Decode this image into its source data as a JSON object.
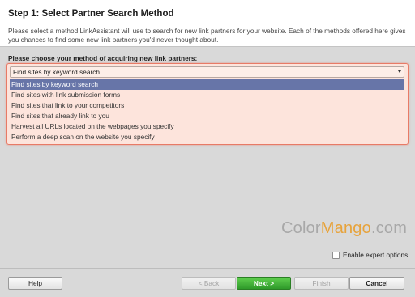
{
  "header": {
    "title": "Step 1: Select Partner Search Method",
    "description": "Please select a method LinkAssistant will use to search for new link partners for your website. Each of the methods offered here gives you chances to find some new link partners you'd never thought about."
  },
  "method": {
    "prompt": "Please choose your method of acquiring new link partners:",
    "selected": "Find sites by keyword search",
    "options": [
      "Find sites by keyword search",
      "Find sites with link submission forms",
      "Find sites that link to your competitors",
      "Find sites that already link to you",
      "Harvest all URLs located on the webpages you specify",
      "Perform a deep scan on the website you specify"
    ],
    "selected_index": 0
  },
  "watermark": {
    "part1": "Color",
    "part2": "Mango",
    "part3": ".com"
  },
  "expert": {
    "label": "Enable expert options",
    "checked": false
  },
  "buttons": {
    "help": "Help",
    "back": "< Back",
    "next": "Next >",
    "finish": "Finish",
    "cancel": "Cancel"
  },
  "colors": {
    "highlight": "#6775a8",
    "frame_border": "#e87a66",
    "next_button": "#3aaa33",
    "watermark_accent": "#e7a33c"
  }
}
